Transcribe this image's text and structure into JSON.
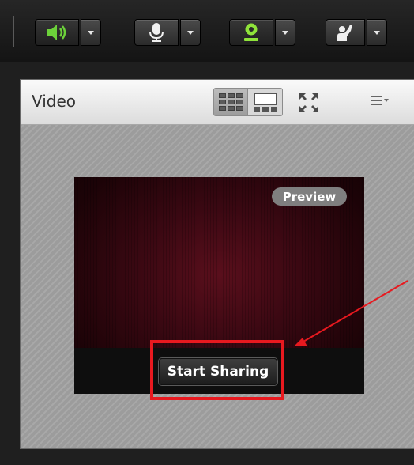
{
  "toolbar": {
    "buttons": [
      {
        "name": "speaker",
        "icon": "speaker-icon",
        "active": true,
        "color": "#6cd13a"
      },
      {
        "name": "microphone",
        "icon": "microphone-icon",
        "active": false,
        "color": "#f0f0f0"
      },
      {
        "name": "webcam",
        "icon": "webcam-icon",
        "active": true,
        "color": "#8fe33a"
      },
      {
        "name": "status",
        "icon": "raise-hand-icon",
        "active": false,
        "color": "#f0f0f0"
      }
    ]
  },
  "pod": {
    "title": "Video",
    "layout_options": [
      "grid-layout",
      "filmstrip-layout"
    ],
    "selected_layout": "grid-layout"
  },
  "preview": {
    "badge": "Preview",
    "start_label": "Start Sharing"
  },
  "annotation": {
    "color": "#e8191f"
  }
}
